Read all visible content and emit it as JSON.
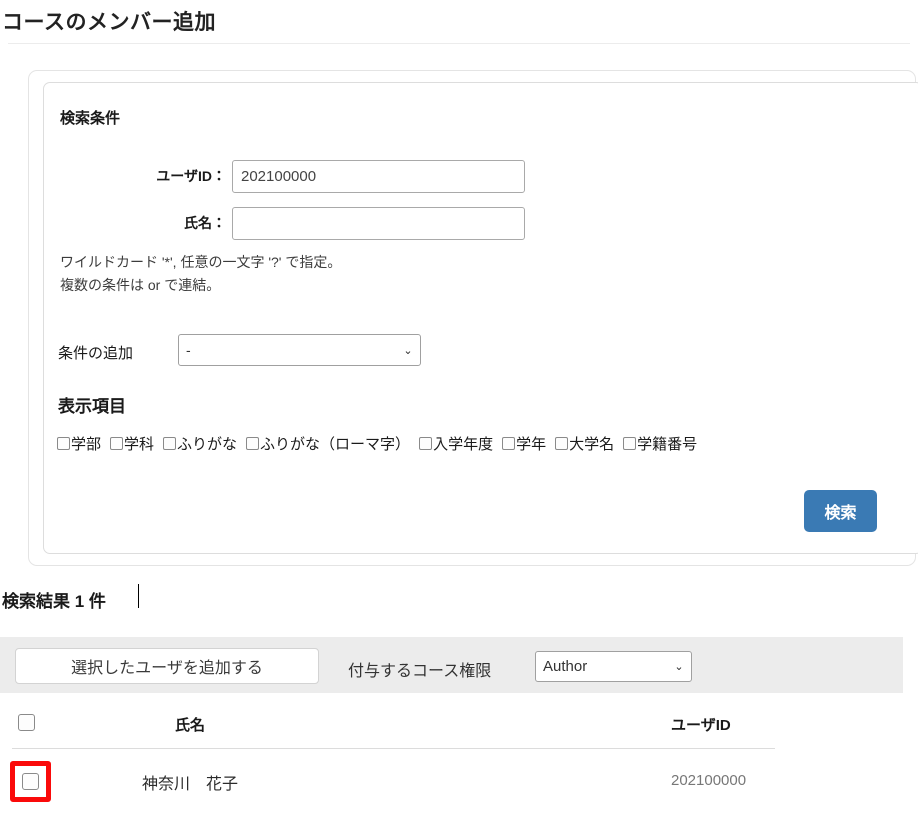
{
  "page": {
    "title": "コースのメンバー追加"
  },
  "search_panel": {
    "heading": "検索条件",
    "user_id": {
      "label": "ユーザID：",
      "value": "202100000",
      "placeholder": ""
    },
    "name": {
      "label": "氏名：",
      "value": "",
      "placeholder": ""
    },
    "hints": [
      "ワイルドカード '*', 任意の一文字 '?' で指定。",
      "複数の条件は or で連結。"
    ],
    "add_condition": {
      "label": "条件の追加",
      "selected": "-",
      "options": [
        "-"
      ]
    },
    "display_items": {
      "heading": "表示項目",
      "checkboxes": [
        {
          "label": "学部",
          "checked": false
        },
        {
          "label": "学科",
          "checked": false
        },
        {
          "label": "ふりがな",
          "checked": false
        },
        {
          "label": "ふりがな（ローマ字）",
          "checked": false
        },
        {
          "label": "入学年度",
          "checked": false
        },
        {
          "label": "学年",
          "checked": false
        },
        {
          "label": "大学名",
          "checked": false
        },
        {
          "label": "学籍番号",
          "checked": false
        }
      ]
    },
    "search_button": "検索"
  },
  "results": {
    "heading": "検索結果 1 件",
    "add_selected_button": "選択したユーザを追加する",
    "grant_role": {
      "label": "付与するコース権限",
      "selected": "Author",
      "options": [
        "Author"
      ]
    },
    "table": {
      "columns": [
        "",
        "氏名",
        "ユーザID"
      ],
      "header_select_all_checked": false,
      "rows": [
        {
          "checked": false,
          "name": "神奈川　花子",
          "user_id": "202100000"
        }
      ]
    }
  },
  "annotation": {
    "color": "#fa0a0a",
    "target": "row-select-checkbox"
  },
  "icons": {
    "chevron_down": "⌄"
  },
  "colors": {
    "accent_button": "#3a7ab4",
    "toolbar_background": "#ececec",
    "annotation_red": "#fa0a0a"
  }
}
